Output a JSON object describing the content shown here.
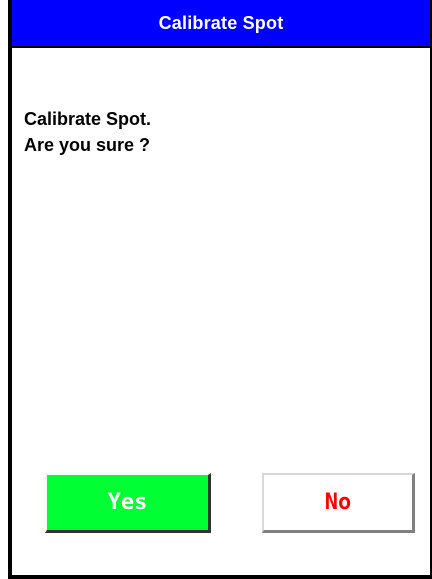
{
  "dialog": {
    "title": "Calibrate Spot",
    "message_line1": "Calibrate Spot.",
    "message_line2": "Are you sure ?",
    "yes_label": "Yes",
    "no_label": "No"
  },
  "colors": {
    "title_bar": "#0000ff",
    "title_text": "#ffffff",
    "yes_bg": "#00ff33",
    "yes_text": "#ffffff",
    "no_bg": "#ffffff",
    "no_text": "#ff0000"
  }
}
